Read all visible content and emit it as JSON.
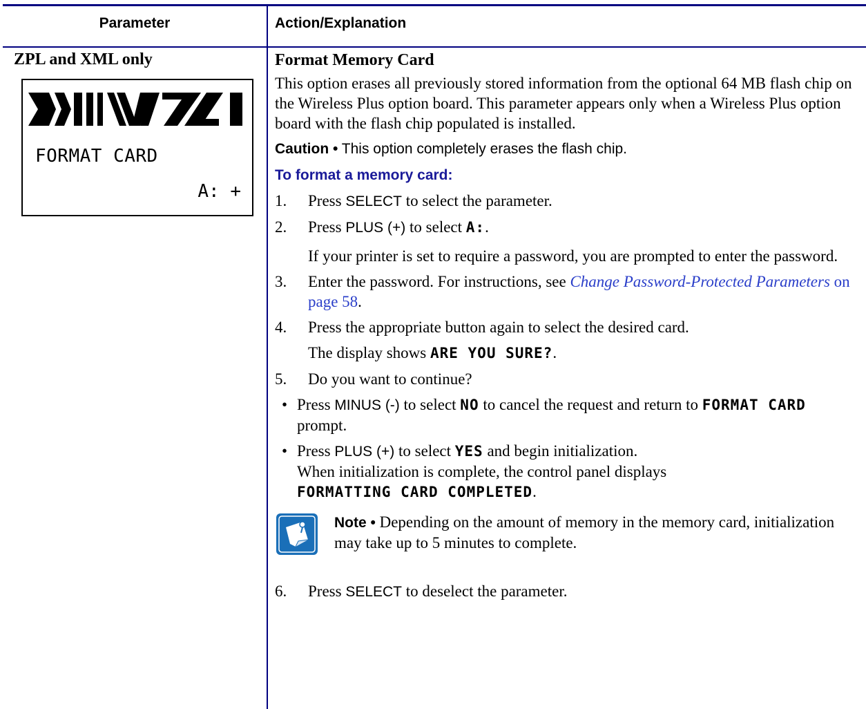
{
  "header": {
    "parameter": "Parameter",
    "action": "Action/Explanation"
  },
  "left": {
    "label": "ZPL and XML only",
    "lcd_line1": "FORMAT CARD",
    "lcd_line2": "A: +"
  },
  "right": {
    "title": "Format Memory Card",
    "intro": "This option erases all previously stored information from the optional 64 MB flash chip on the Wireless Plus option board. This parameter appears only when a Wireless Plus option board with the flash chip populated is installed.",
    "caution_label": "Caution •",
    "caution_text": " This option completely erases the flash chip.",
    "procedure_title": "To format a memory card:",
    "step1_num": "1.",
    "step1_a": "Press ",
    "step1_key": "SELECT",
    "step1_b": " to select the parameter.",
    "step2_num": "2.",
    "step2_a": "Press ",
    "step2_key": "PLUS (+)",
    "step2_b": " to select ",
    "step2_lcd": "A:",
    "step2_c": ".",
    "step2_sub": "If your printer is set to require a password, you are prompted to enter the password.",
    "step3_num": "3.",
    "step3_a": "Enter the password. For instructions, see ",
    "step3_link": "Change Password-Protected Parameters",
    "step3_b": " on page 58",
    "step3_c": ".",
    "step4_num": "4.",
    "step4_text": "Press the appropriate button again to select the desired card.",
    "step4_sub_a": "The display shows ",
    "step4_sub_lcd": "ARE YOU SURE?",
    "step4_sub_b": ".",
    "step5_num": "5.",
    "step5_text": "Do you want to continue?",
    "bullet1_a": "Press ",
    "bullet1_key": "MINUS (-)",
    "bullet1_b": " to select ",
    "bullet1_lcd": "NO",
    "bullet1_c": " to cancel the request and return to ",
    "bullet1_lcd2": "FORMAT CARD",
    "bullet1_d": " prompt.",
    "bullet2_a": "Press ",
    "bullet2_key": "PLUS (+)",
    "bullet2_b": " to select ",
    "bullet2_lcd": "YES",
    "bullet2_c": " and begin initialization.",
    "bullet2_line2": "When initialization is complete, the control panel displays",
    "bullet2_lcd2": "FORMATTING CARD COMPLETED",
    "bullet2_d": ".",
    "note_label": "Note •",
    "note_text": " Depending on the amount of memory in the memory card, initialization may take up to 5 minutes to complete.",
    "step6_num": "6.",
    "step6_a": "Press ",
    "step6_key": "SELECT",
    "step6_b": " to deselect the parameter."
  }
}
